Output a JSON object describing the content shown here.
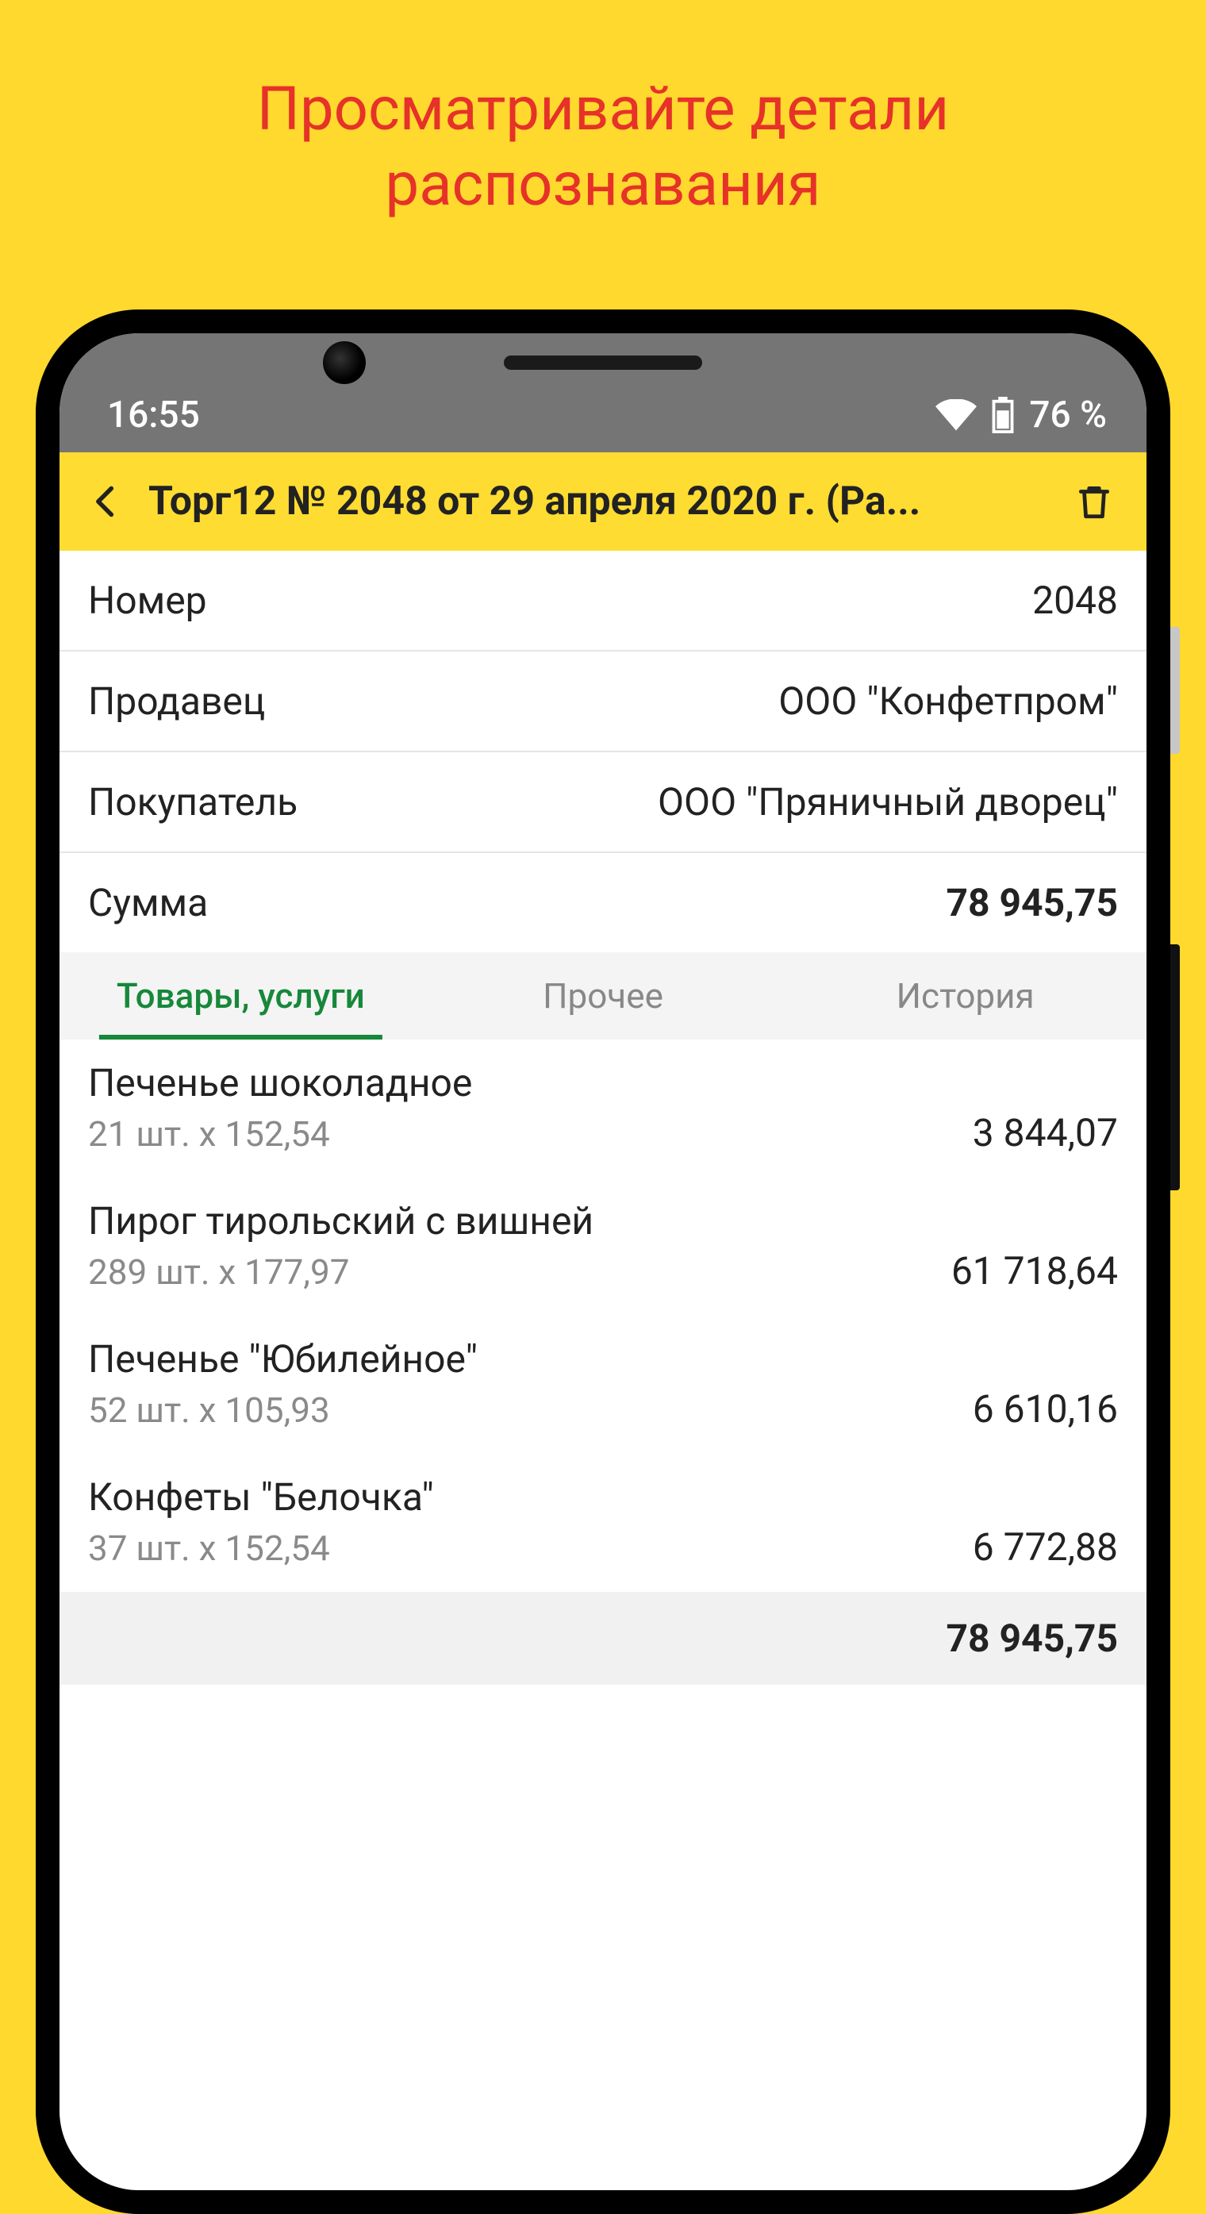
{
  "promo": {
    "line1": "Просматривайте детали",
    "line2": "распознавания"
  },
  "status_bar": {
    "time": "16:55",
    "battery_text": "76 %"
  },
  "app_bar": {
    "title": "Торг12 № 2048 от 29 апреля 2020 г. (Ра..."
  },
  "info": [
    {
      "label": "Номер",
      "value": "2048",
      "bold": false
    },
    {
      "label": "Продавец",
      "value": "ООО \"Конфетпром\"",
      "bold": false
    },
    {
      "label": "Покупатель",
      "value": "ООО \"Пряничный дворец\"",
      "bold": false
    },
    {
      "label": "Сумма",
      "value": "78 945,75",
      "bold": true
    }
  ],
  "tabs": [
    {
      "label": "Товары, услуги",
      "active": true
    },
    {
      "label": "Прочее",
      "active": false
    },
    {
      "label": "История",
      "active": false
    }
  ],
  "products": [
    {
      "name": "Печенье шоколадное",
      "qty": "21 шт. x 152,54",
      "amount": "3 844,07"
    },
    {
      "name": "Пирог тирольский с вишней",
      "qty": "289 шт. x 177,97",
      "amount": "61 718,64"
    },
    {
      "name": "Печенье \"Юбилейное\"",
      "qty": "52 шт. x 105,93",
      "amount": "6 610,16"
    },
    {
      "name": "Конфеты \"Белочка\"",
      "qty": "37 шт. x 152,54",
      "amount": "6 772,88"
    }
  ],
  "total": "78 945,75"
}
